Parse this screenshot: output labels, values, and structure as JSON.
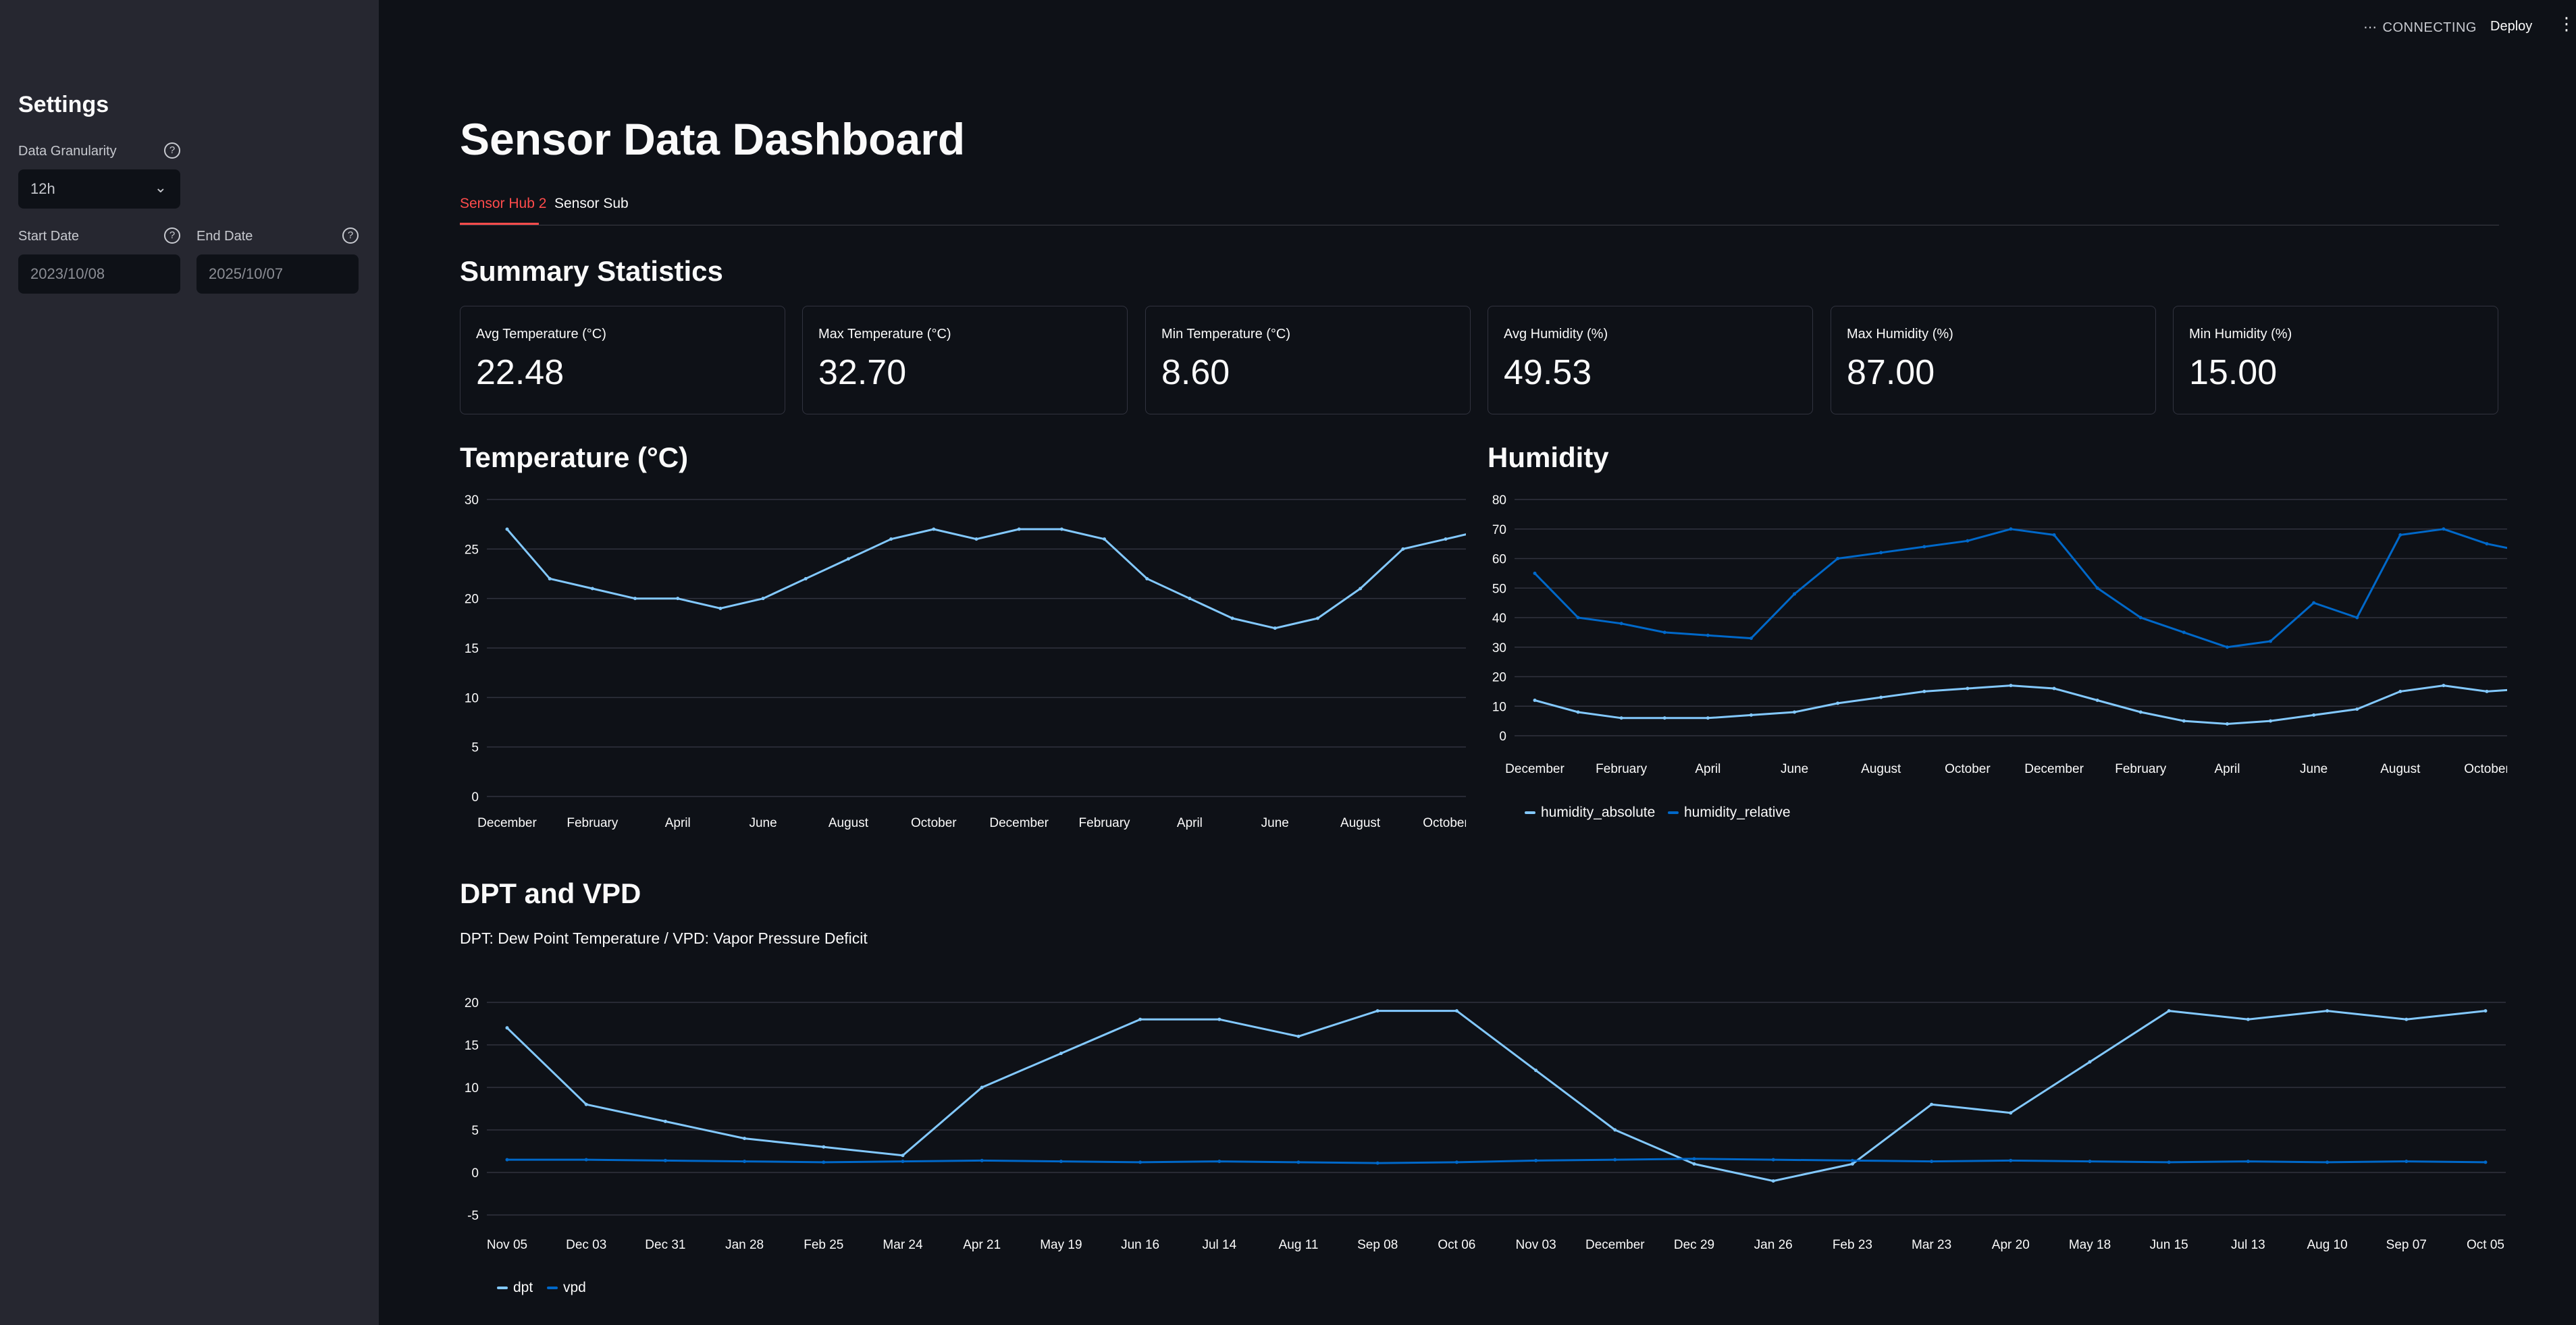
{
  "header": {
    "status": "CONNECTING",
    "deploy_label": "Deploy"
  },
  "sidebar": {
    "title": "Settings",
    "granularity_label": "Data Granularity",
    "granularity_value": "12h",
    "start_date_label": "Start Date",
    "start_date_value": "2023/10/08",
    "end_date_label": "End Date",
    "end_date_value": "2025/10/07"
  },
  "page": {
    "title": "Sensor Data Dashboard",
    "tabs": [
      "Sensor Hub 2",
      "Sensor Sub"
    ],
    "summary_heading": "Summary Statistics",
    "temp_heading": "Temperature (°C)",
    "humidity_heading": "Humidity",
    "dpt_heading": "DPT and VPD",
    "dpt_caption": "DPT: Dew Point Temperature / VPD: Vapor Pressure Deficit"
  },
  "metrics": [
    {
      "label": "Avg Temperature (°C)",
      "value": "22.48"
    },
    {
      "label": "Max Temperature (°C)",
      "value": "32.70"
    },
    {
      "label": "Min Temperature (°C)",
      "value": "8.60"
    },
    {
      "label": "Avg Humidity (%)",
      "value": "49.53"
    },
    {
      "label": "Max Humidity (%)",
      "value": "87.00"
    },
    {
      "label": "Min Humidity (%)",
      "value": "15.00"
    }
  ],
  "colors": {
    "light_blue": "#83c9ff",
    "dark_blue": "#0068c9",
    "accent": "#ff4b4b"
  },
  "chart_data": [
    {
      "type": "line",
      "title": "Temperature (°C)",
      "ylim": [
        0,
        30
      ],
      "yticks": [
        0,
        5,
        10,
        15,
        20,
        25,
        30
      ],
      "x_tick_labels": [
        "December",
        "February",
        "April",
        "June",
        "August",
        "October",
        "December",
        "February",
        "April",
        "June",
        "August",
        "October"
      ],
      "series": [
        {
          "x": [
            0,
            0.5,
            1,
            1.5,
            2,
            2.5,
            3,
            3.5,
            4,
            4.5,
            5,
            5.5,
            6,
            6.5,
            7,
            7.5,
            8,
            8.5,
            9,
            9.5,
            10,
            10.5,
            11,
            11.5
          ],
          "values": [
            27,
            22,
            21,
            20,
            20,
            19,
            20,
            22,
            24,
            26,
            27,
            26,
            27,
            27,
            26,
            22,
            20,
            18,
            17,
            18,
            21,
            25,
            26,
            27
          ]
        }
      ]
    },
    {
      "type": "line",
      "title": "Humidity",
      "ylim": [
        0,
        80
      ],
      "yticks": [
        0,
        10,
        20,
        30,
        40,
        50,
        60,
        70,
        80
      ],
      "x_tick_labels": [
        "December",
        "February",
        "April",
        "June",
        "August",
        "October",
        "December",
        "February",
        "April",
        "June",
        "August",
        "October"
      ],
      "series": [
        {
          "name": "humidity_absolute",
          "x": [
            0,
            0.5,
            1,
            1.5,
            2,
            2.5,
            3,
            3.5,
            4,
            4.5,
            5,
            5.5,
            6,
            6.5,
            7,
            7.5,
            8,
            8.5,
            9,
            9.5,
            10,
            10.5,
            11,
            11.5
          ],
          "values": [
            12,
            8,
            6,
            6,
            6,
            7,
            8,
            11,
            13,
            15,
            16,
            17,
            16,
            12,
            8,
            5,
            4,
            5,
            7,
            9,
            15,
            17,
            15,
            16
          ]
        },
        {
          "name": "humidity_relative",
          "x": [
            0,
            0.5,
            1,
            1.5,
            2,
            2.5,
            3,
            3.5,
            4,
            4.5,
            5,
            5.5,
            6,
            6.5,
            7,
            7.5,
            8,
            8.5,
            9,
            9.5,
            10,
            10.5,
            11,
            11.5
          ],
          "values": [
            55,
            40,
            38,
            35,
            34,
            33,
            48,
            60,
            62,
            64,
            66,
            70,
            68,
            50,
            40,
            35,
            30,
            32,
            45,
            40,
            68,
            70,
            65,
            62
          ]
        }
      ]
    },
    {
      "type": "line",
      "title": "DPT and VPD",
      "ylim": [
        -5,
        20
      ],
      "yticks": [
        -5,
        0,
        5,
        10,
        15,
        20
      ],
      "x_tick_labels": [
        "Nov 05",
        "Dec 03",
        "Dec 31",
        "Jan 28",
        "Feb 25",
        "Mar 24",
        "Apr 21",
        "May 19",
        "Jun 16",
        "Jul 14",
        "Aug 11",
        "Sep 08",
        "Oct 06",
        "Nov 03",
        "December",
        "Dec 29",
        "Jan 26",
        "Feb 23",
        "Mar 23",
        "Apr 20",
        "May 18",
        "Jun 15",
        "Jul 13",
        "Aug 10",
        "Sep 07",
        "Oct 05"
      ],
      "series": [
        {
          "name": "dpt",
          "x": [
            0,
            1,
            2,
            3,
            4,
            5,
            6,
            7,
            8,
            9,
            10,
            11,
            12,
            13,
            14,
            15,
            16,
            17,
            18,
            19,
            20,
            21,
            22,
            23,
            24,
            25
          ],
          "values": [
            17,
            8,
            6,
            4,
            3,
            2,
            10,
            14,
            18,
            18,
            16,
            19,
            19,
            12,
            5,
            1,
            -1,
            1,
            8,
            7,
            13,
            19,
            18,
            19,
            18,
            19
          ]
        },
        {
          "name": "vpd",
          "x": [
            0,
            1,
            2,
            3,
            4,
            5,
            6,
            7,
            8,
            9,
            10,
            11,
            12,
            13,
            14,
            15,
            16,
            17,
            18,
            19,
            20,
            21,
            22,
            23,
            24,
            25
          ],
          "values": [
            1.5,
            1.5,
            1.4,
            1.3,
            1.2,
            1.3,
            1.4,
            1.3,
            1.2,
            1.3,
            1.2,
            1.1,
            1.2,
            1.4,
            1.5,
            1.6,
            1.5,
            1.4,
            1.3,
            1.4,
            1.3,
            1.2,
            1.3,
            1.2,
            1.3,
            1.2
          ]
        }
      ]
    }
  ]
}
